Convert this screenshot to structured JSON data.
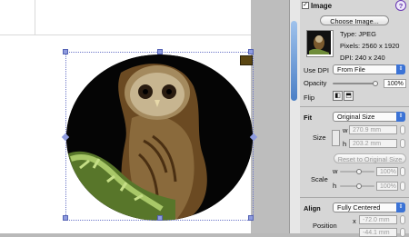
{
  "inspector": {
    "section_title": "Image",
    "help_glyph": "?",
    "choose_image_label": "Choose Image...",
    "info": {
      "type": "Type: JPEG",
      "pixels": "Pixels: 2560 x 1920",
      "dpi": "DPI: 240 x 240"
    },
    "use_dpi_label": "Use DPI",
    "use_dpi_value": "From File",
    "opacity_label": "Opacity",
    "opacity_value": "100%",
    "opacity_level": 1.0,
    "flip_label": "Flip",
    "fit_label": "Fit",
    "fit_value": "Original Size",
    "size_label": "Size",
    "width_prefix": "w",
    "width_value": "270.9 mm",
    "height_prefix": "h",
    "height_value": "203.2 mm",
    "reset_label": "Reset to Original Size",
    "scale_label": "Scale",
    "scale_w_prefix": "w",
    "scale_w_value": "100%",
    "scale_h_prefix": "h",
    "scale_h_value": "100%",
    "align_label": "Align",
    "align_value": "Fully Centered",
    "position_label": "Position",
    "pos_x_prefix": "x",
    "pos_x_value": "-72.0 mm",
    "pos_y_value": "-44.1 mm"
  },
  "colors": {
    "selection": "#6b76c9",
    "accent": "#3b73d6"
  }
}
